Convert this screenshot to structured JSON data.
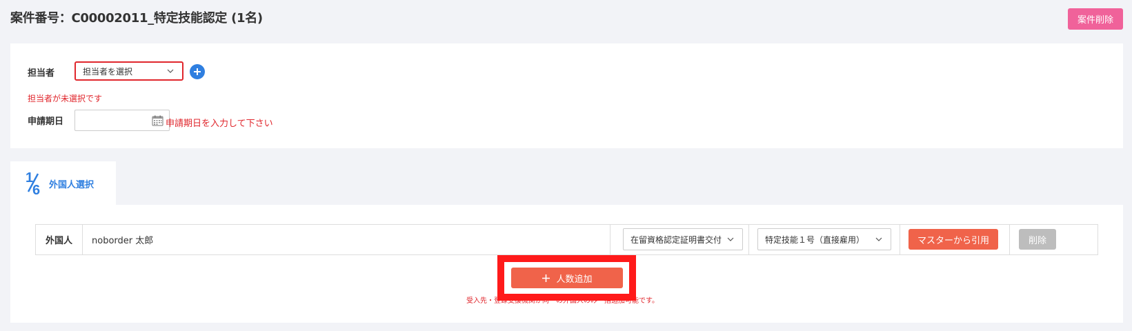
{
  "header": {
    "title": "案件番号：C00002011_特定技能認定 (1名)",
    "delete_case_label": "案件削除"
  },
  "form": {
    "assignee_label": "担当者",
    "assignee_select_value": "担当者を選択",
    "assignee_error": "担当者が未選択です",
    "apply_date_label": "申請期日",
    "apply_date_value": "",
    "apply_date_error": "申請期日を入力して下さい"
  },
  "step_tab": {
    "numerator": "1",
    "denominator": "6",
    "label": "外国人選択"
  },
  "foreigner_rows": [
    {
      "label": "外国人",
      "name": "noborder 太郎",
      "status_select": "在留資格認定証明書交付",
      "visa_select": "特定技能１号（直接雇用）",
      "master_button": "マスターから引用",
      "delete_button": "削除"
    }
  ],
  "add_count_button": "人数追加",
  "note_text": "受入先・登録支援機関が同一の外国人のみ一括追加可能です。",
  "colors": {
    "accent_blue": "#2f7fe0",
    "error_red": "#e0262c",
    "button_orange": "#f0634a",
    "delete_pink": "#f0629a",
    "highlight_red": "#ff1a1a"
  }
}
